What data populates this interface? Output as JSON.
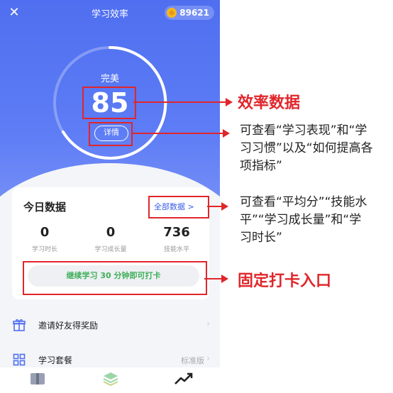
{
  "app": {
    "title": "学习效率",
    "coins": "89621"
  },
  "score": {
    "label": "完美",
    "value": "85",
    "detail_button": "详情"
  },
  "today_card": {
    "title": "今日数据",
    "all_data_link": "全部数据 >",
    "stats": [
      {
        "value": "0",
        "label": "学习时长"
      },
      {
        "value": "0",
        "label": "学习成长量"
      },
      {
        "value": "736",
        "label": "技能水平"
      }
    ],
    "checkin_button": "继续学习 30 分钟即可打卡"
  },
  "menu": [
    {
      "label": "邀请好友得奖励",
      "icon": "gift-icon",
      "right": ""
    },
    {
      "label": "学习套餐",
      "icon": "grid-icon",
      "right": "标准版"
    }
  ],
  "tabs": [
    {
      "icon": "book-icon"
    },
    {
      "icon": "layers-icon"
    },
    {
      "icon": "trend-icon"
    }
  ],
  "annotations": {
    "efficiency": "效率数据",
    "detail_note": [
      "可查看“学习表现”和“学",
      "习习惯”以及“如何提高各",
      "项指标”"
    ],
    "all_data_note": [
      "可查看“平均分”“技能水",
      "平”“学习成长量”和“学",
      "习时长”"
    ],
    "checkin": "固定打卡入口"
  },
  "colors": {
    "accent": "#4f6ff0",
    "annotation_red": "#e0262b",
    "checkin_green": "#3fae5a",
    "coin": "#f5b81f"
  }
}
